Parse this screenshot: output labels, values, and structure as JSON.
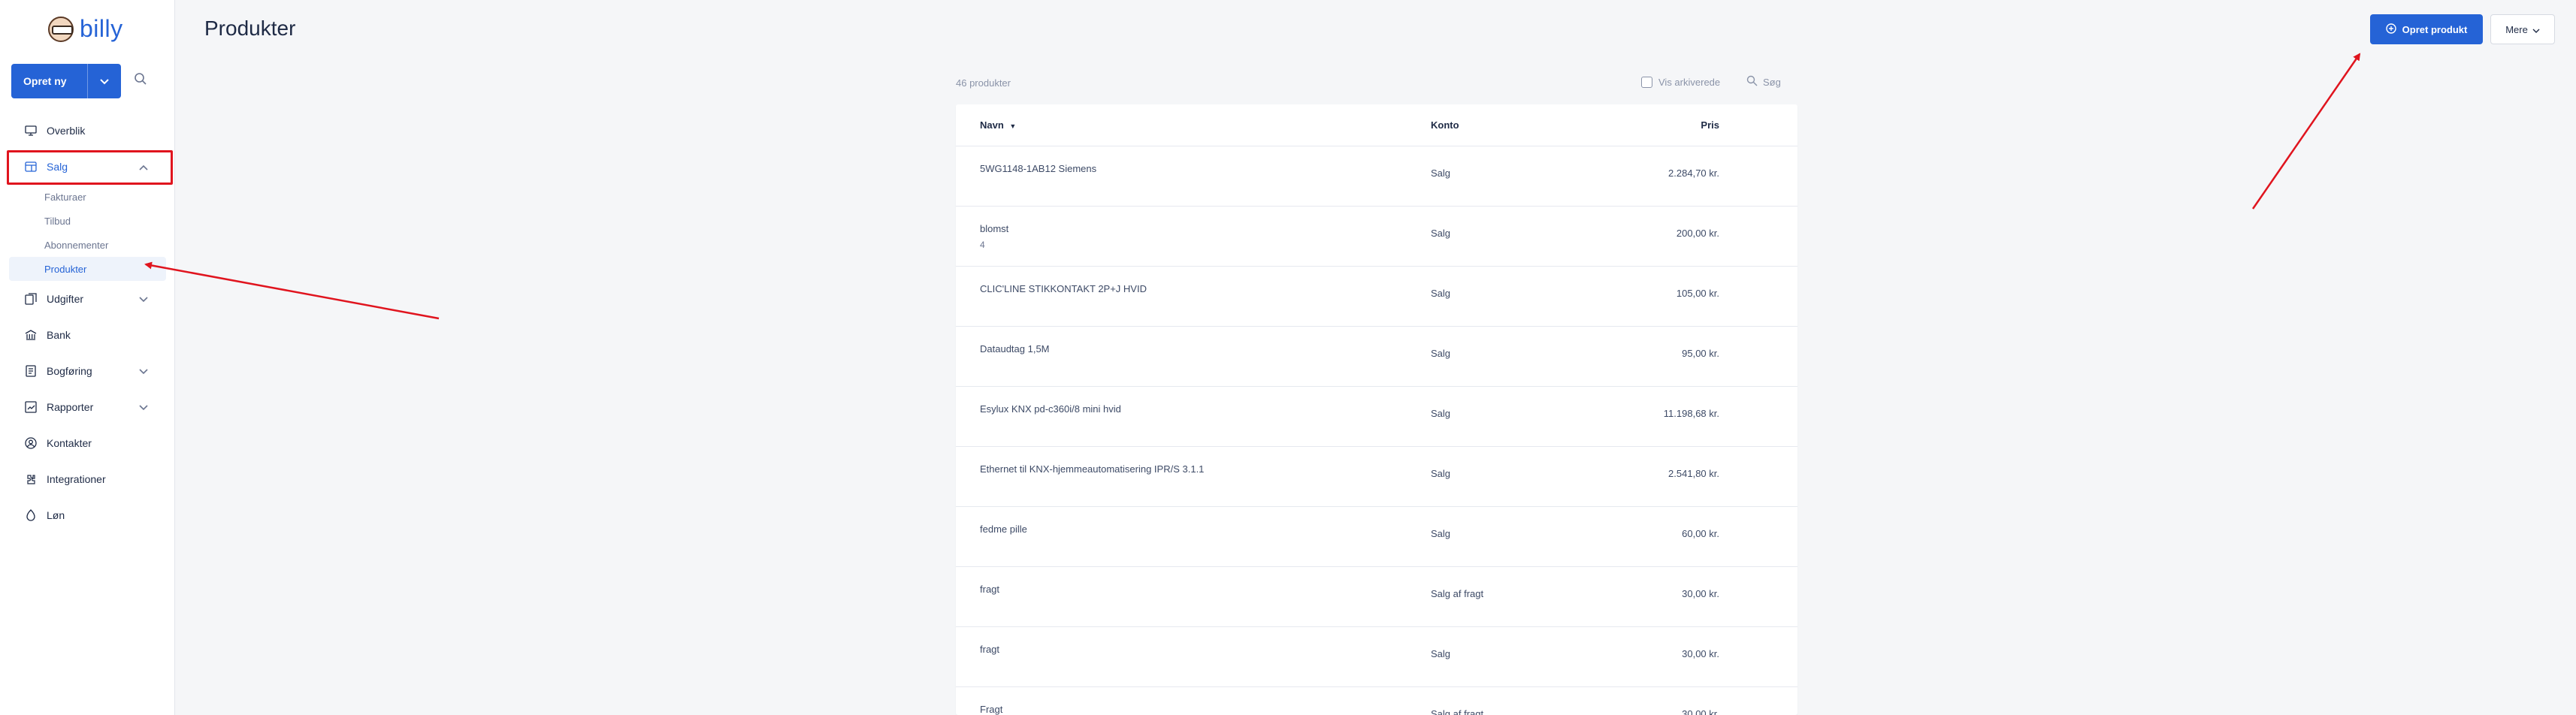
{
  "app": {
    "logo_text": "billy"
  },
  "sidebar": {
    "create_label": "Opret ny",
    "nav": [
      {
        "label": "Overblik",
        "icon": "monitor-icon"
      },
      {
        "label": "Salg",
        "icon": "sales-icon",
        "expanded": true
      },
      {
        "label": "Udgifter",
        "icon": "expenses-icon"
      },
      {
        "label": "Bank",
        "icon": "bank-icon"
      },
      {
        "label": "Bogføring",
        "icon": "ledger-icon"
      },
      {
        "label": "Rapporter",
        "icon": "reports-icon"
      },
      {
        "label": "Kontakter",
        "icon": "contacts-icon"
      },
      {
        "label": "Integrationer",
        "icon": "integrations-icon"
      },
      {
        "label": "Løn",
        "icon": "salary-icon"
      }
    ],
    "salg_sub": [
      {
        "label": "Fakturaer"
      },
      {
        "label": "Tilbud"
      },
      {
        "label": "Abonnementer"
      },
      {
        "label": "Produkter",
        "current": true
      }
    ]
  },
  "header": {
    "title": "Produkter",
    "create_product_label": "Opret produkt",
    "more_label": "Mere"
  },
  "toolbar": {
    "count": "46 produkter",
    "archive_label": "Vis arkiverede",
    "search_label": "Søg"
  },
  "table": {
    "columns": {
      "name": "Navn",
      "konto": "Konto",
      "pris": "Pris"
    },
    "rows": [
      {
        "name": "5WG1148-1AB12 Siemens",
        "sub": "",
        "konto": "Salg",
        "pris": "2.284,70 kr."
      },
      {
        "name": "blomst",
        "sub": "4",
        "konto": "Salg",
        "pris": "200,00 kr."
      },
      {
        "name": "CLIC'LINE STIKKONTAKT 2P+J HVID",
        "sub": "",
        "konto": "Salg",
        "pris": "105,00 kr."
      },
      {
        "name": "Dataudtag 1,5M",
        "sub": "",
        "konto": "Salg",
        "pris": "95,00 kr."
      },
      {
        "name": "Esylux KNX pd-c360i/8 mini hvid",
        "sub": "",
        "konto": "Salg",
        "pris": "11.198,68 kr."
      },
      {
        "name": "Ethernet til KNX-hjemmeautomatisering IPR/S 3.1.1",
        "sub": "",
        "konto": "Salg",
        "pris": "2.541,80 kr."
      },
      {
        "name": "fedme pille",
        "sub": "",
        "konto": "Salg",
        "pris": "60,00 kr."
      },
      {
        "name": "fragt",
        "sub": "",
        "konto": "Salg af fragt",
        "pris": "30,00 kr."
      },
      {
        "name": "fragt",
        "sub": "",
        "konto": "Salg",
        "pris": "30,00 kr."
      },
      {
        "name": "Fragt",
        "sub": "",
        "konto": "Salg af fragt",
        "pris": "30,00 kr."
      }
    ]
  },
  "colors": {
    "accent": "#2563d6",
    "annotation": "#e0141e"
  }
}
